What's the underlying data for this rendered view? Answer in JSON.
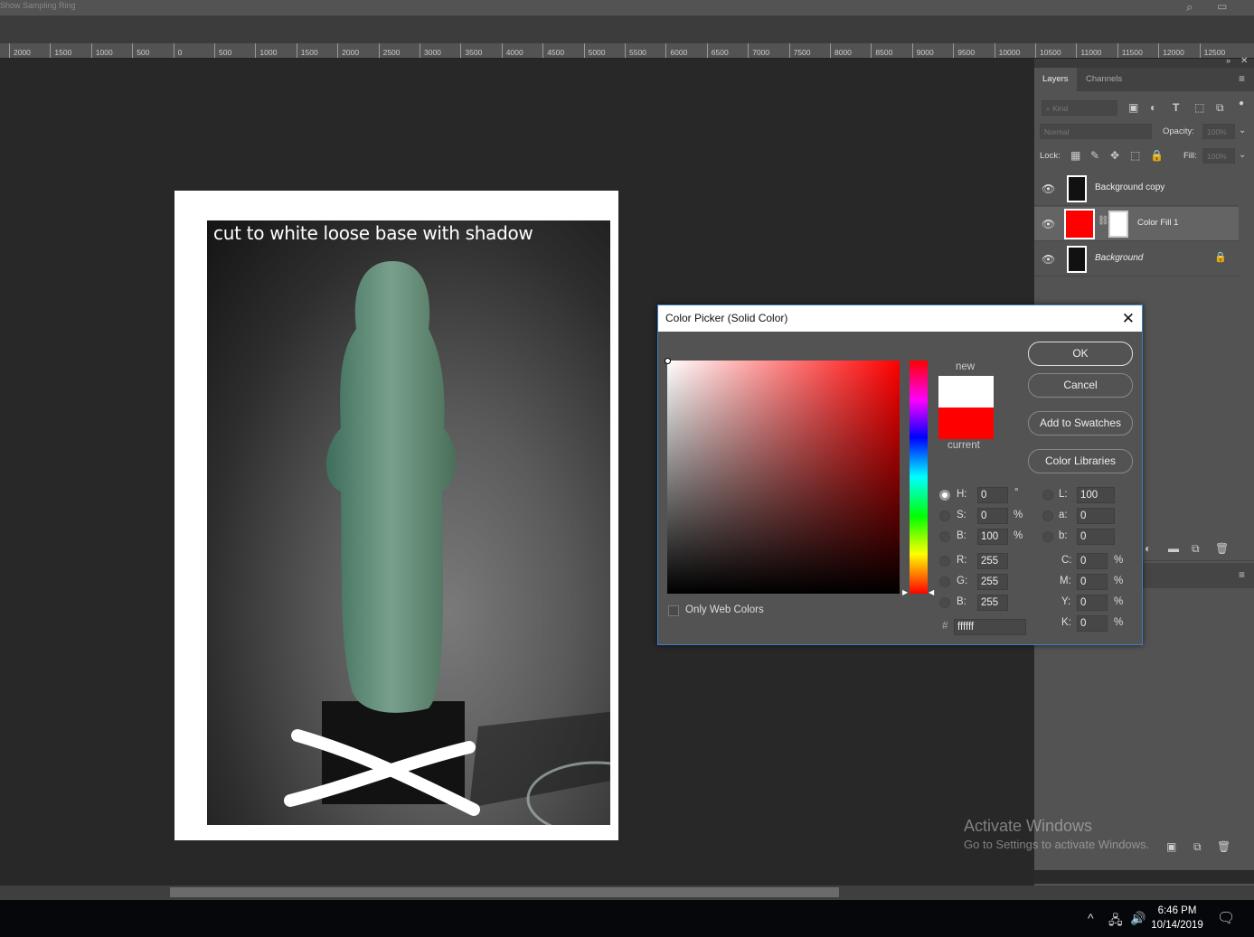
{
  "options_bar": {
    "label": "Show Sampling Ring",
    "icons": [
      "search-icon",
      "workspace-icon"
    ]
  },
  "ruler": {
    "ticks": [
      "2000",
      "1500",
      "1000",
      "500",
      "0",
      "500",
      "1000",
      "1500",
      "2000",
      "2500",
      "3000",
      "3500",
      "4000",
      "4500",
      "5000",
      "5500",
      "6000",
      "6500",
      "7000",
      "7500",
      "8000",
      "8500",
      "9000",
      "9500",
      "10000",
      "10500",
      "11000",
      "11500",
      "12000",
      "12500"
    ]
  },
  "document": {
    "caption": "cut to white loose base with shadow"
  },
  "layers_panel": {
    "tabs": [
      {
        "label": "Layers",
        "active": true
      },
      {
        "label": "Channels",
        "active": false
      }
    ],
    "filter_placeholder": "Kind",
    "blend_mode": "Normal",
    "opacity_label": "Opacity:",
    "opacity_value": "100%",
    "lock_label": "Lock:",
    "fill_label": "Fill:",
    "fill_value": "100%",
    "layers": [
      {
        "name": "Background copy",
        "visible": true,
        "selected": false,
        "locked": false,
        "italic": false
      },
      {
        "name": "Color Fill 1",
        "visible": true,
        "selected": true,
        "locked": false,
        "italic": false,
        "fill_color": "#ff0000"
      },
      {
        "name": "Background",
        "visible": true,
        "selected": false,
        "locked": true,
        "italic": true
      }
    ]
  },
  "color_picker": {
    "title": "Color Picker (Solid Color)",
    "new_label": "new",
    "current_label": "current",
    "new_color": "#ffffff",
    "current_color": "#ff0000",
    "buttons": {
      "ok": "OK",
      "cancel": "Cancel",
      "add_to_swatches": "Add to Swatches",
      "color_libraries": "Color Libraries"
    },
    "only_web_colors": "Only Web Colors",
    "only_web_colors_checked": false,
    "hsb": {
      "H": "0",
      "S": "0",
      "B": "100",
      "H_unit": "°",
      "S_unit": "%",
      "B_unit": "%"
    },
    "rgb": {
      "R": "255",
      "G": "255",
      "B": "255"
    },
    "lab": {
      "L": "100",
      "a": "0",
      "b": "0"
    },
    "cmyk": {
      "C": "0",
      "M": "0",
      "Y": "0",
      "K": "0",
      "unit": "%"
    },
    "hex": "ffffff",
    "selected_mode": "H",
    "labels": {
      "H": "H:",
      "S": "S:",
      "B": "B:",
      "R": "R:",
      "G": "G:",
      "Bb": "B:",
      "L": "L:",
      "a": "a:",
      "b": "b:",
      "C": "C:",
      "M": "M:",
      "Y": "Y:",
      "K": "K:",
      "hash": "#"
    }
  },
  "watermark": {
    "line1": "Activate Windows",
    "line2": "Go to Settings to activate Windows."
  },
  "taskbar": {
    "time": "6:46 PM",
    "date": "10/14/2019"
  }
}
